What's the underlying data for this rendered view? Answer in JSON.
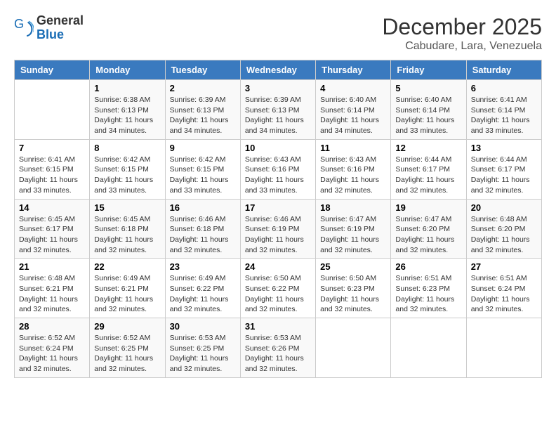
{
  "header": {
    "logo_general": "General",
    "logo_blue": "Blue",
    "title": "December 2025",
    "location": "Cabudare, Lara, Venezuela"
  },
  "weekdays": [
    "Sunday",
    "Monday",
    "Tuesday",
    "Wednesday",
    "Thursday",
    "Friday",
    "Saturday"
  ],
  "weeks": [
    [
      {
        "day": "",
        "sunrise": "",
        "sunset": "",
        "daylight": ""
      },
      {
        "day": "1",
        "sunrise": "Sunrise: 6:38 AM",
        "sunset": "Sunset: 6:13 PM",
        "daylight": "Daylight: 11 hours and 34 minutes."
      },
      {
        "day": "2",
        "sunrise": "Sunrise: 6:39 AM",
        "sunset": "Sunset: 6:13 PM",
        "daylight": "Daylight: 11 hours and 34 minutes."
      },
      {
        "day": "3",
        "sunrise": "Sunrise: 6:39 AM",
        "sunset": "Sunset: 6:13 PM",
        "daylight": "Daylight: 11 hours and 34 minutes."
      },
      {
        "day": "4",
        "sunrise": "Sunrise: 6:40 AM",
        "sunset": "Sunset: 6:14 PM",
        "daylight": "Daylight: 11 hours and 34 minutes."
      },
      {
        "day": "5",
        "sunrise": "Sunrise: 6:40 AM",
        "sunset": "Sunset: 6:14 PM",
        "daylight": "Daylight: 11 hours and 33 minutes."
      },
      {
        "day": "6",
        "sunrise": "Sunrise: 6:41 AM",
        "sunset": "Sunset: 6:14 PM",
        "daylight": "Daylight: 11 hours and 33 minutes."
      }
    ],
    [
      {
        "day": "7",
        "sunrise": "Sunrise: 6:41 AM",
        "sunset": "Sunset: 6:15 PM",
        "daylight": "Daylight: 11 hours and 33 minutes."
      },
      {
        "day": "8",
        "sunrise": "Sunrise: 6:42 AM",
        "sunset": "Sunset: 6:15 PM",
        "daylight": "Daylight: 11 hours and 33 minutes."
      },
      {
        "day": "9",
        "sunrise": "Sunrise: 6:42 AM",
        "sunset": "Sunset: 6:15 PM",
        "daylight": "Daylight: 11 hours and 33 minutes."
      },
      {
        "day": "10",
        "sunrise": "Sunrise: 6:43 AM",
        "sunset": "Sunset: 6:16 PM",
        "daylight": "Daylight: 11 hours and 33 minutes."
      },
      {
        "day": "11",
        "sunrise": "Sunrise: 6:43 AM",
        "sunset": "Sunset: 6:16 PM",
        "daylight": "Daylight: 11 hours and 32 minutes."
      },
      {
        "day": "12",
        "sunrise": "Sunrise: 6:44 AM",
        "sunset": "Sunset: 6:17 PM",
        "daylight": "Daylight: 11 hours and 32 minutes."
      },
      {
        "day": "13",
        "sunrise": "Sunrise: 6:44 AM",
        "sunset": "Sunset: 6:17 PM",
        "daylight": "Daylight: 11 hours and 32 minutes."
      }
    ],
    [
      {
        "day": "14",
        "sunrise": "Sunrise: 6:45 AM",
        "sunset": "Sunset: 6:17 PM",
        "daylight": "Daylight: 11 hours and 32 minutes."
      },
      {
        "day": "15",
        "sunrise": "Sunrise: 6:45 AM",
        "sunset": "Sunset: 6:18 PM",
        "daylight": "Daylight: 11 hours and 32 minutes."
      },
      {
        "day": "16",
        "sunrise": "Sunrise: 6:46 AM",
        "sunset": "Sunset: 6:18 PM",
        "daylight": "Daylight: 11 hours and 32 minutes."
      },
      {
        "day": "17",
        "sunrise": "Sunrise: 6:46 AM",
        "sunset": "Sunset: 6:19 PM",
        "daylight": "Daylight: 11 hours and 32 minutes."
      },
      {
        "day": "18",
        "sunrise": "Sunrise: 6:47 AM",
        "sunset": "Sunset: 6:19 PM",
        "daylight": "Daylight: 11 hours and 32 minutes."
      },
      {
        "day": "19",
        "sunrise": "Sunrise: 6:47 AM",
        "sunset": "Sunset: 6:20 PM",
        "daylight": "Daylight: 11 hours and 32 minutes."
      },
      {
        "day": "20",
        "sunrise": "Sunrise: 6:48 AM",
        "sunset": "Sunset: 6:20 PM",
        "daylight": "Daylight: 11 hours and 32 minutes."
      }
    ],
    [
      {
        "day": "21",
        "sunrise": "Sunrise: 6:48 AM",
        "sunset": "Sunset: 6:21 PM",
        "daylight": "Daylight: 11 hours and 32 minutes."
      },
      {
        "day": "22",
        "sunrise": "Sunrise: 6:49 AM",
        "sunset": "Sunset: 6:21 PM",
        "daylight": "Daylight: 11 hours and 32 minutes."
      },
      {
        "day": "23",
        "sunrise": "Sunrise: 6:49 AM",
        "sunset": "Sunset: 6:22 PM",
        "daylight": "Daylight: 11 hours and 32 minutes."
      },
      {
        "day": "24",
        "sunrise": "Sunrise: 6:50 AM",
        "sunset": "Sunset: 6:22 PM",
        "daylight": "Daylight: 11 hours and 32 minutes."
      },
      {
        "day": "25",
        "sunrise": "Sunrise: 6:50 AM",
        "sunset": "Sunset: 6:23 PM",
        "daylight": "Daylight: 11 hours and 32 minutes."
      },
      {
        "day": "26",
        "sunrise": "Sunrise: 6:51 AM",
        "sunset": "Sunset: 6:23 PM",
        "daylight": "Daylight: 11 hours and 32 minutes."
      },
      {
        "day": "27",
        "sunrise": "Sunrise: 6:51 AM",
        "sunset": "Sunset: 6:24 PM",
        "daylight": "Daylight: 11 hours and 32 minutes."
      }
    ],
    [
      {
        "day": "28",
        "sunrise": "Sunrise: 6:52 AM",
        "sunset": "Sunset: 6:24 PM",
        "daylight": "Daylight: 11 hours and 32 minutes."
      },
      {
        "day": "29",
        "sunrise": "Sunrise: 6:52 AM",
        "sunset": "Sunset: 6:25 PM",
        "daylight": "Daylight: 11 hours and 32 minutes."
      },
      {
        "day": "30",
        "sunrise": "Sunrise: 6:53 AM",
        "sunset": "Sunset: 6:25 PM",
        "daylight": "Daylight: 11 hours and 32 minutes."
      },
      {
        "day": "31",
        "sunrise": "Sunrise: 6:53 AM",
        "sunset": "Sunset: 6:26 PM",
        "daylight": "Daylight: 11 hours and 32 minutes."
      },
      {
        "day": "",
        "sunrise": "",
        "sunset": "",
        "daylight": ""
      },
      {
        "day": "",
        "sunrise": "",
        "sunset": "",
        "daylight": ""
      },
      {
        "day": "",
        "sunrise": "",
        "sunset": "",
        "daylight": ""
      }
    ]
  ]
}
